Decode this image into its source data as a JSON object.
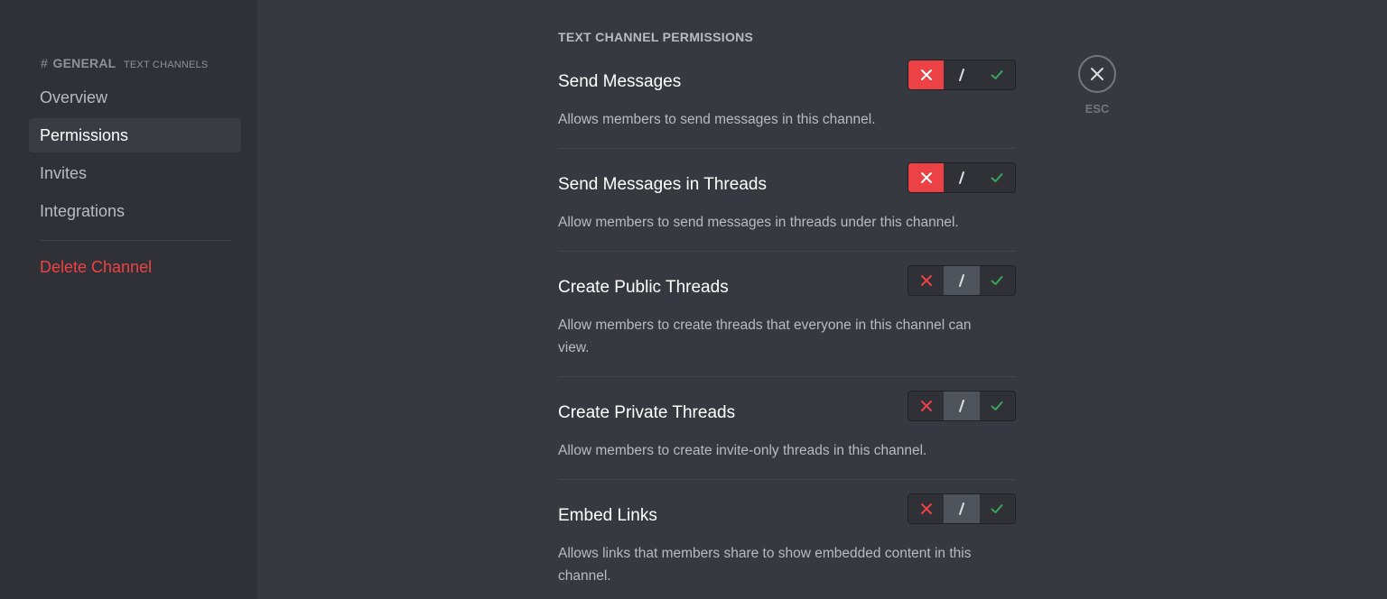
{
  "sidebar": {
    "channel_hash": "#",
    "channel_name": "GENERAL",
    "channel_category": "TEXT CHANNELS",
    "items": [
      {
        "label": "Overview"
      },
      {
        "label": "Permissions"
      },
      {
        "label": "Invites"
      },
      {
        "label": "Integrations"
      }
    ],
    "delete_label": "Delete Channel"
  },
  "main": {
    "section_title": "TEXT CHANNEL PERMISSIONS",
    "permissions": [
      {
        "name": "Send Messages",
        "description": "Allows members to send messages in this channel.",
        "state": "deny"
      },
      {
        "name": "Send Messages in Threads",
        "description": "Allow members to send messages in threads under this channel.",
        "state": "deny"
      },
      {
        "name": "Create Public Threads",
        "description": "Allow members to create threads that everyone in this channel can view.",
        "state": "neutral"
      },
      {
        "name": "Create Private Threads",
        "description": "Allow members to create invite-only threads in this channel.",
        "state": "neutral"
      },
      {
        "name": "Embed Links",
        "description": "Allows links that members share to show embedded content in this channel.",
        "state": "neutral"
      }
    ]
  },
  "close": {
    "label": "ESC"
  },
  "colors": {
    "deny": "#ed4245",
    "allow": "#3ba55d",
    "neutral_active": "#4f545c"
  },
  "icons": {
    "deny": "x-icon",
    "neutral": "slash-icon",
    "allow": "check-icon",
    "close": "close-icon"
  }
}
